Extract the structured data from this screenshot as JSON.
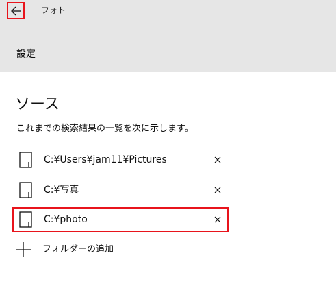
{
  "header": {
    "app_title": "フォト",
    "settings_title": "設定"
  },
  "sources": {
    "title": "ソース",
    "description": "これまでの検索結果の一覧を次に示します。",
    "folders": [
      {
        "path": "C:¥Users¥jam11¥Pictures",
        "remove_label": "×"
      },
      {
        "path": "C:¥写真",
        "remove_label": "×"
      },
      {
        "path": "C:¥photo",
        "remove_label": "×"
      }
    ],
    "add_folder_label": "フォルダーの追加"
  },
  "colors": {
    "header_bg": "#e6e6e6",
    "highlight": "#e8141c"
  },
  "icons": {
    "back": "back-arrow-icon",
    "folder": "folder-icon",
    "remove": "close-icon",
    "add": "plus-icon"
  }
}
